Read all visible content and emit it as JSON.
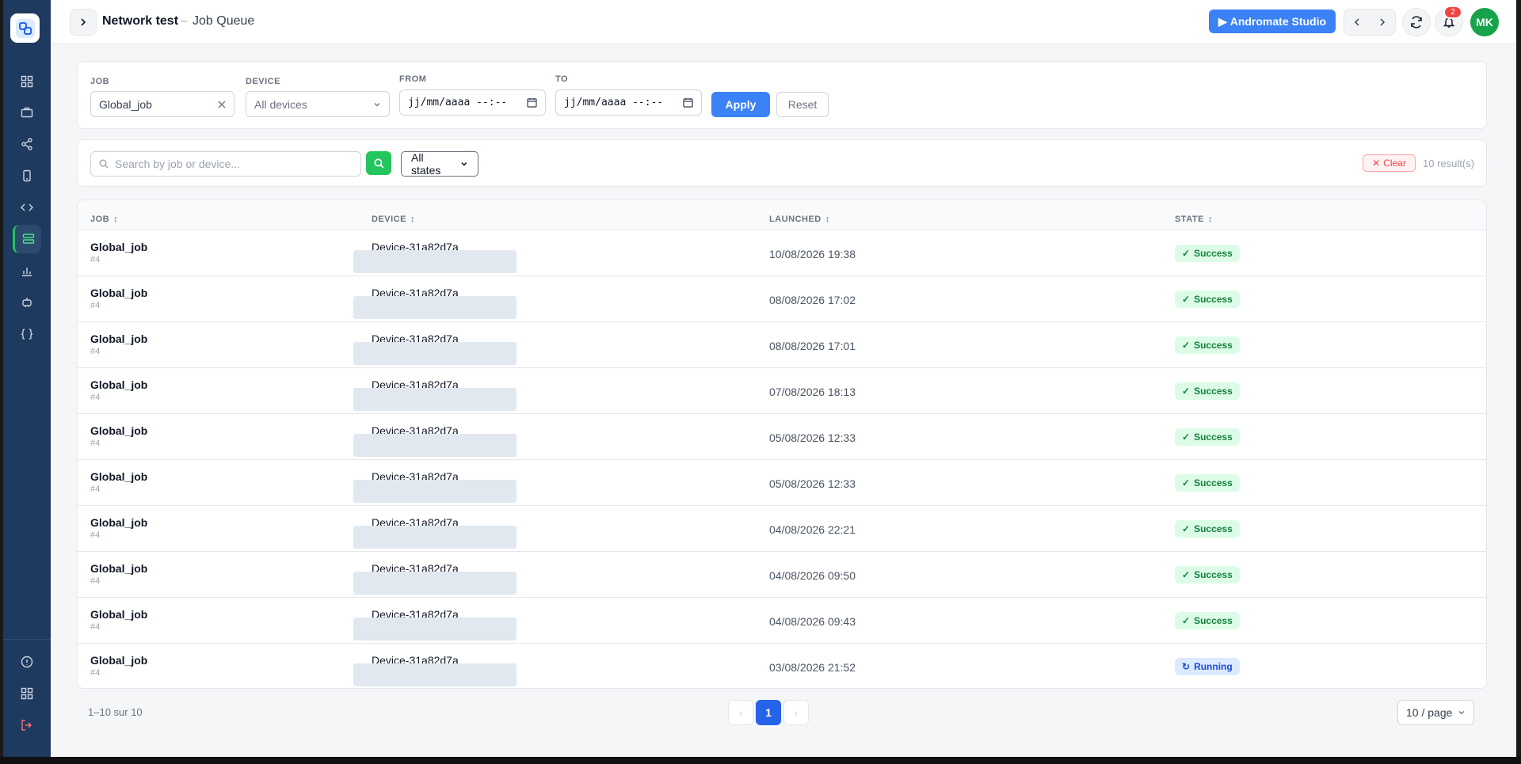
{
  "header": {
    "title": "Network test",
    "separator": "–",
    "page": "Job Queue",
    "studio_label": "Andromate Studio",
    "notif_count": "2",
    "avatar_initials": "MK"
  },
  "filters": {
    "job_label": "JOB",
    "job_value": "Global_job",
    "device_label": "DEVICE",
    "device_value": "All devices",
    "from_label": "FROM",
    "from_placeholder": "jj/mm/aaaa --:--",
    "to_label": "TO",
    "to_placeholder": "jj/mm/aaaa --:--",
    "apply_label": "Apply",
    "reset_label": "Reset"
  },
  "search": {
    "placeholder": "Search by job or device...",
    "state_value": "All states",
    "clear_label": "Clear",
    "results": "10 result(s)"
  },
  "table": {
    "columns": [
      "JOB",
      "DEVICE",
      "LAUNCHED",
      "STATE"
    ],
    "rows": [
      {
        "job": "Global_job",
        "num": "#4",
        "device": "Device-31a82d7a",
        "launched": "10/08/2026 19:38",
        "state": "Success"
      },
      {
        "job": "Global_job",
        "num": "#4",
        "device": "Device-31a82d7a",
        "launched": "08/08/2026 17:02",
        "state": "Success"
      },
      {
        "job": "Global_job",
        "num": "#4",
        "device": "Device-31a82d7a",
        "launched": "08/08/2026 17:01",
        "state": "Success"
      },
      {
        "job": "Global_job",
        "num": "#4",
        "device": "Device-31a82d7a",
        "launched": "07/08/2026 18:13",
        "state": "Success"
      },
      {
        "job": "Global_job",
        "num": "#4",
        "device": "Device-31a82d7a",
        "launched": "05/08/2026 12:33",
        "state": "Success"
      },
      {
        "job": "Global_job",
        "num": "#4",
        "device": "Device-31a82d7a",
        "launched": "05/08/2026 12:33",
        "state": "Success"
      },
      {
        "job": "Global_job",
        "num": "#4",
        "device": "Device-31a82d7a",
        "launched": "04/08/2026 22:21",
        "state": "Success"
      },
      {
        "job": "Global_job",
        "num": "#4",
        "device": "Device-31a82d7a",
        "launched": "04/08/2026 09:50",
        "state": "Success"
      },
      {
        "job": "Global_job",
        "num": "#4",
        "device": "Device-31a82d7a",
        "launched": "04/08/2026 09:43",
        "state": "Success"
      },
      {
        "job": "Global_job",
        "num": "#4",
        "device": "Device-31a82d7a",
        "launched": "03/08/2026 21:52",
        "state": "Running"
      }
    ]
  },
  "pagination": {
    "range": "1–10 sur 10",
    "prev": "‹",
    "current": "1",
    "next": "›",
    "per_page": "10 / page"
  },
  "colors": {
    "sidebar": "#1f3a5f",
    "accent": "#3b82f6",
    "success": "#15803d",
    "running": "#1d4ed8"
  }
}
